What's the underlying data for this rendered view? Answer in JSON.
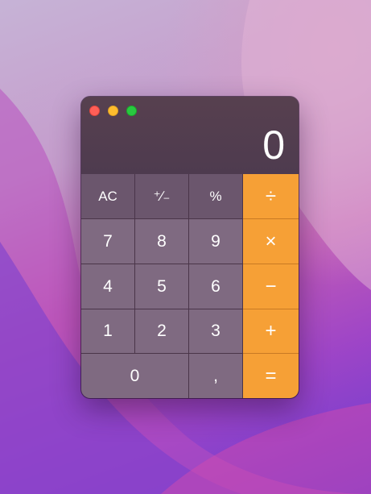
{
  "window": {
    "traffic_lights": [
      {
        "name": "close",
        "color": "#fe5f57"
      },
      {
        "name": "minimize",
        "color": "#febc2e"
      },
      {
        "name": "zoom",
        "color": "#28c840"
      }
    ]
  },
  "display": {
    "value": "0"
  },
  "keys": {
    "clear": "AC",
    "sign": "⁺∕₋",
    "percent": "%",
    "divide": "÷",
    "seven": "7",
    "eight": "8",
    "nine": "9",
    "multiply": "×",
    "four": "4",
    "five": "5",
    "six": "6",
    "subtract": "−",
    "one": "1",
    "two": "2",
    "three": "3",
    "add": "+",
    "zero": "0",
    "decimal": ",",
    "equals": "="
  },
  "colors": {
    "operator": "#f6a036",
    "function_key": "#6b566d",
    "number_key": "#7f6a81",
    "display_bg": "#4f3a52"
  }
}
